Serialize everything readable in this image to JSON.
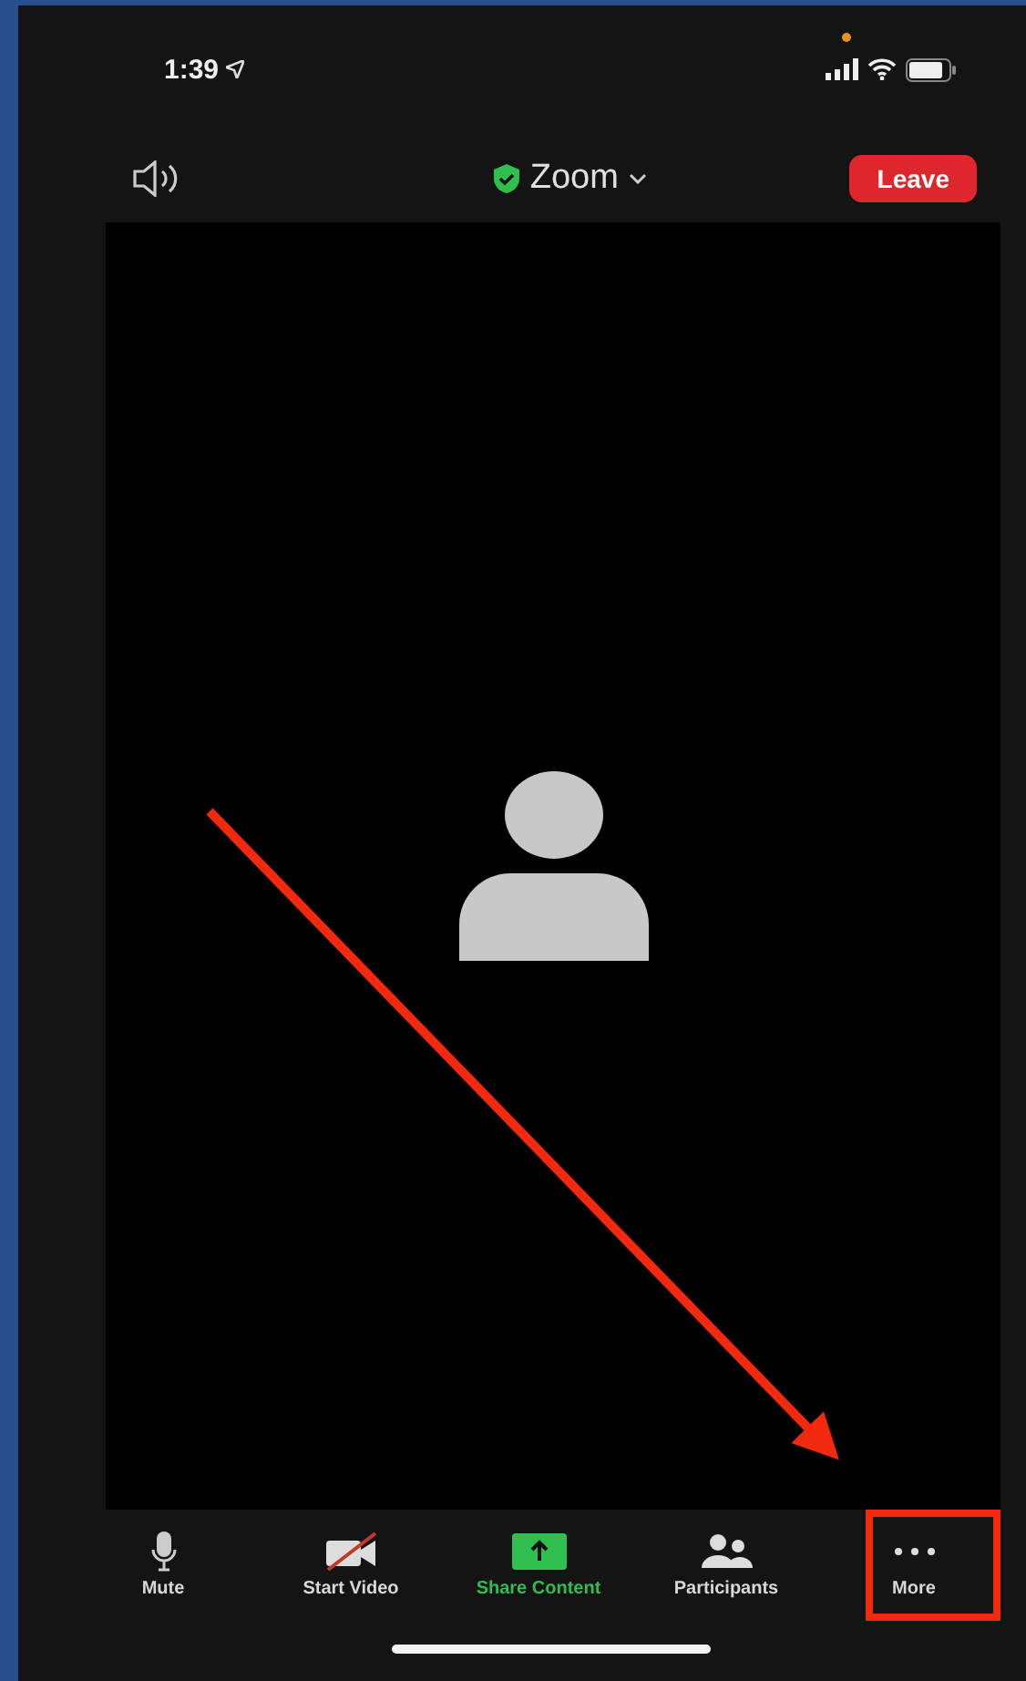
{
  "status_bar": {
    "time": "1:39"
  },
  "top_bar": {
    "title": "Zoom",
    "leave_button": "Leave"
  },
  "toolbar": [
    {
      "kind": "mic",
      "label": "Mute",
      "color": "#d8d8d8"
    },
    {
      "kind": "video-off",
      "label": "Start Video",
      "color": "#d8d8d8"
    },
    {
      "kind": "share",
      "label": "Share Content",
      "color": "#2fbf4f"
    },
    {
      "kind": "participants",
      "label": "Participants",
      "color": "#d8d8d8"
    },
    {
      "kind": "more",
      "label": "More",
      "color": "#d8d8d8"
    }
  ]
}
